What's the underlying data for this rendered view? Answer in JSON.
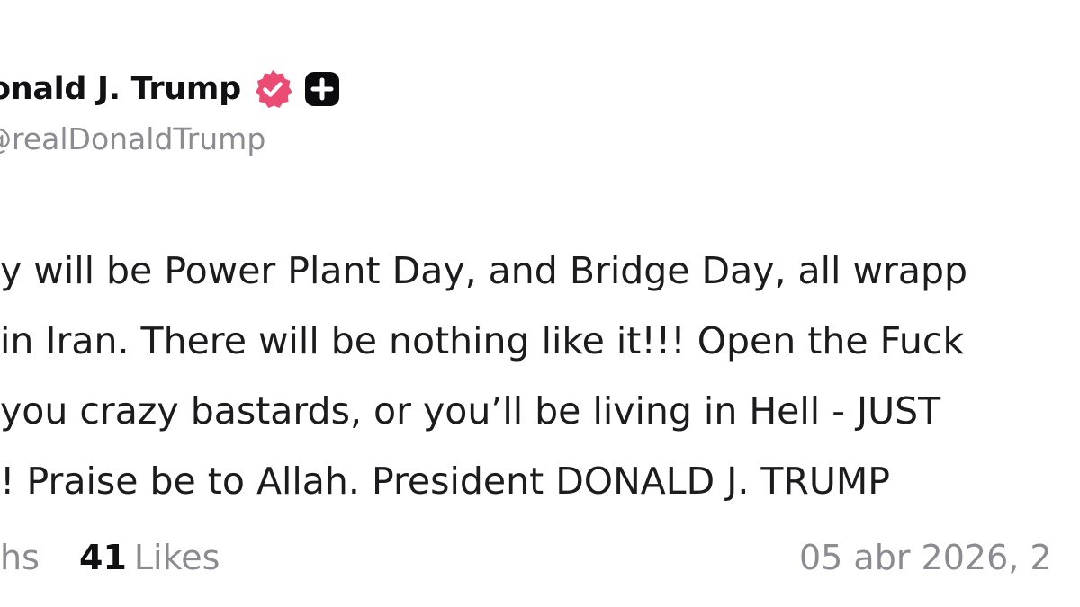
{
  "author": {
    "name_partial": "onald J. Trump",
    "handle_partial": "@realDonaldTrump",
    "verified_color": "#ea4c74",
    "plus_badge_color": "#0b0b0f",
    "verified_icon": "verified-check-icon",
    "plus_icon": "plus-badge-icon"
  },
  "post": {
    "lines": [
      "y will be Power Plant Day, and Bridge Day, all wrapp",
      "in Iran. There will be nothing like it!!! Open the Fuck",
      "you crazy bastards, or you’ll be living in Hell - JUST",
      "! Praise be to Allah. President DONALD J. TRUMP"
    ]
  },
  "stats": {
    "partial_label": "hs",
    "likes_count": "41",
    "likes_label": "Likes",
    "date_partial": "05 abr 2026, 2"
  }
}
